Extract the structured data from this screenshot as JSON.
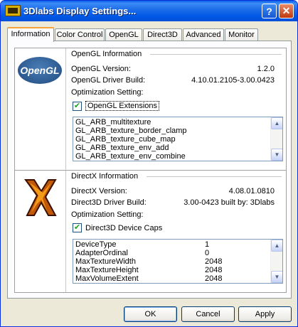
{
  "window": {
    "title": "3Dlabs Display Settings...",
    "help_label": "?",
    "close_label": "✕"
  },
  "tabs": [
    {
      "label": "Information",
      "active": true
    },
    {
      "label": "Color Control"
    },
    {
      "label": "OpenGL"
    },
    {
      "label": "Direct3D"
    },
    {
      "label": "Advanced"
    },
    {
      "label": "Monitor"
    }
  ],
  "opengl": {
    "logo_text": "OpenGL",
    "section_title": "OpenGL Information",
    "version_label": "OpenGL Version:",
    "version_value": "1.2.0",
    "driver_label": "OpenGL Driver Build:",
    "driver_value": "4.10.01.2105-3.00.0423",
    "optimization_label": "Optimization Setting:",
    "extensions_checkbox_label": "OpenGL Extensions",
    "extensions_checked": true,
    "extensions": [
      "GL_ARB_multitexture",
      "GL_ARB_texture_border_clamp",
      "GL_ARB_texture_cube_map",
      "GL_ARB_texture_env_add",
      "GL_ARB_texture_env_combine"
    ]
  },
  "directx": {
    "section_title": "DirectX Information",
    "version_label": "DirectX Version:",
    "version_value": "4.08.01.0810",
    "driver_label": "Direct3D Driver Build:",
    "driver_value": "3.00-0423 built by: 3Dlabs",
    "optimization_label": "Optimization Setting:",
    "caps_checkbox_label": "Direct3D Device Caps",
    "caps_checked": true,
    "caps": [
      {
        "name": "DeviceType",
        "value": "1"
      },
      {
        "name": "AdapterOrdinal",
        "value": "0"
      },
      {
        "name": "MaxTextureWidth",
        "value": "2048"
      },
      {
        "name": "MaxTextureHeight",
        "value": "2048"
      },
      {
        "name": "MaxVolumeExtent",
        "value": "2048"
      }
    ]
  },
  "buttons": {
    "ok": "OK",
    "cancel": "Cancel",
    "apply": "Apply"
  },
  "colors": {
    "titlebar": "#0058e6",
    "dialog_bg": "#ece9d8",
    "tab_highlight": "#f7a33c"
  }
}
